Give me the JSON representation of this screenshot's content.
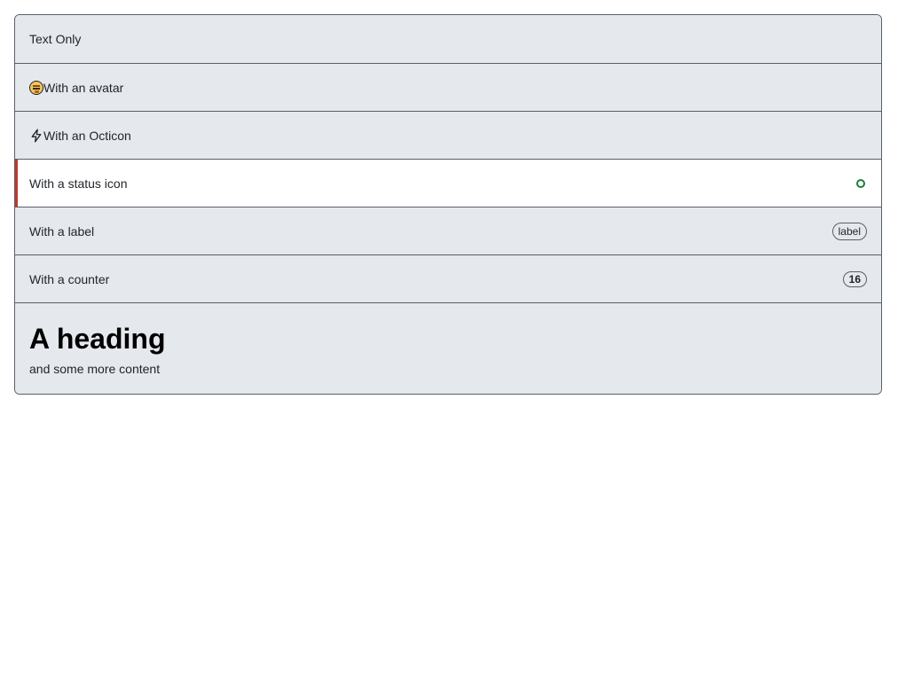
{
  "list": {
    "items": [
      {
        "label": "Text Only"
      },
      {
        "label": "With an avatar",
        "icon": "avatar-icon"
      },
      {
        "label": "With an Octicon",
        "icon": "zap-icon"
      },
      {
        "label": "With a status icon",
        "trailing_icon": "status-dot-icon",
        "status_color": "#1a7f37",
        "accent_color": "#c0392b"
      },
      {
        "label": "With a label",
        "badge": "label"
      },
      {
        "label": "With a counter",
        "counter": "16"
      }
    ],
    "heading_item": {
      "heading": "A heading",
      "body": "and some more content"
    }
  },
  "colors": {
    "item_bg": "#e5e8ed",
    "active_bg": "#ffffff",
    "border": "#57606a"
  }
}
